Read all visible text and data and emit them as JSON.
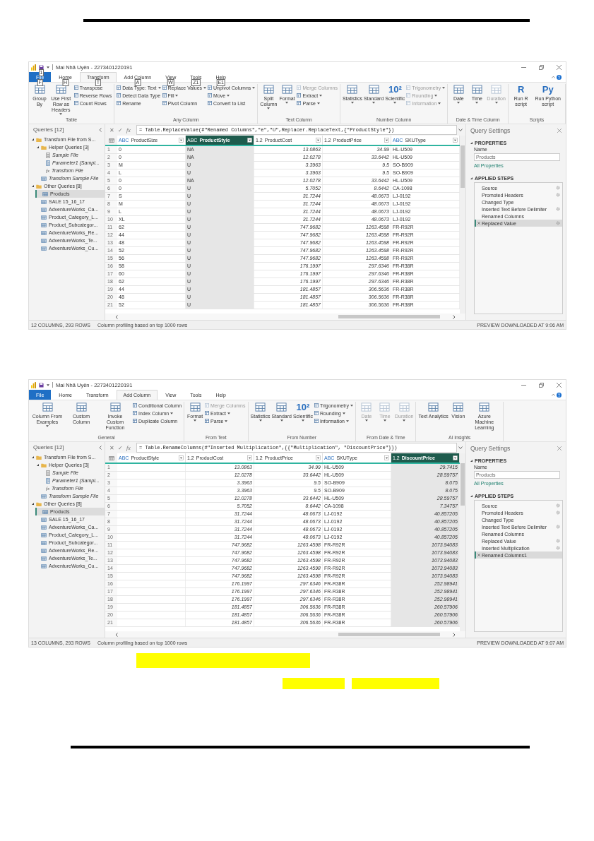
{
  "windows": [
    {
      "title_bar": {
        "title": "Mai Nhã Uyên - 2273401220191",
        "save_keytip": "1"
      },
      "tabs": [
        {
          "label": "File",
          "kind": "file",
          "selected": false,
          "keytip": "F"
        },
        {
          "label": "Home",
          "kind": "tab",
          "selected": false,
          "keytip": "H"
        },
        {
          "label": "Transform",
          "kind": "tab",
          "selected": true,
          "keytip": "T"
        },
        {
          "label": "Add Column",
          "kind": "tab",
          "selected": false,
          "keytip": "A"
        },
        {
          "label": "View",
          "kind": "tab",
          "selected": false,
          "keytip": "W"
        },
        {
          "label": "Tools",
          "kind": "tab",
          "selected": false,
          "keytip": "Z1"
        },
        {
          "label": "Help",
          "kind": "tab",
          "selected": false,
          "keytip": "E1"
        }
      ],
      "ribbon": [
        {
          "label": "Table",
          "items": [
            {
              "label": "Group By",
              "kind": "large",
              "dropdown": false,
              "disabled": false
            },
            {
              "label": "Use First Row as Headers",
              "kind": "large",
              "dropdown": true,
              "disabled": false
            },
            {
              "label": "Transpose",
              "kind": "small",
              "dropdown": false,
              "disabled": false
            },
            {
              "label": "Reverse Rows",
              "kind": "small",
              "dropdown": false,
              "disabled": false
            },
            {
              "label": "Count Rows",
              "kind": "small",
              "dropdown": false,
              "disabled": false
            }
          ]
        },
        {
          "label": "Any Column",
          "items": [
            {
              "label": "Data Type: Text",
              "kind": "small",
              "dropdown": true,
              "disabled": false
            },
            {
              "label": "Detect Data Type",
              "kind": "small",
              "dropdown": false,
              "disabled": false
            },
            {
              "label": "Rename",
              "kind": "small",
              "dropdown": false,
              "disabled": false
            },
            {
              "label": "Replace Values",
              "kind": "small",
              "dropdown": true,
              "disabled": false
            },
            {
              "label": "Fill",
              "kind": "small",
              "dropdown": true,
              "disabled": false
            },
            {
              "label": "Pivot Column",
              "kind": "small",
              "dropdown": false,
              "disabled": false
            },
            {
              "label": "Unpivot Columns",
              "kind": "small",
              "dropdown": true,
              "disabled": false
            },
            {
              "label": "Move",
              "kind": "small",
              "dropdown": true,
              "disabled": false
            },
            {
              "label": "Convert to List",
              "kind": "small",
              "dropdown": false,
              "disabled": false
            }
          ]
        },
        {
          "label": "Text Column",
          "items": [
            {
              "label": "Split Column",
              "kind": "large",
              "dropdown": true,
              "disabled": false
            },
            {
              "label": "Format",
              "kind": "large",
              "dropdown": true,
              "disabled": false
            },
            {
              "label": "Merge Columns",
              "kind": "small",
              "dropdown": false,
              "disabled": true
            },
            {
              "label": "Extract",
              "kind": "small",
              "dropdown": true,
              "disabled": false
            },
            {
              "label": "Parse",
              "kind": "small",
              "dropdown": true,
              "disabled": false
            }
          ]
        },
        {
          "label": "Number Column",
          "items": [
            {
              "label": "Statistics",
              "kind": "large",
              "dropdown": true,
              "disabled": false
            },
            {
              "label": "Standard",
              "kind": "large",
              "dropdown": true,
              "disabled": false
            },
            {
              "label": "Scientific",
              "kind": "large",
              "dropdown": true,
              "disabled": false,
              "icon_text": "10²"
            },
            {
              "label": "Trigonometry",
              "kind": "small",
              "dropdown": true,
              "disabled": true
            },
            {
              "label": "Rounding",
              "kind": "small",
              "dropdown": true,
              "disabled": true
            },
            {
              "label": "Information",
              "kind": "small",
              "dropdown": true,
              "disabled": true
            }
          ]
        },
        {
          "label": "Date & Time Column",
          "items": [
            {
              "label": "Date",
              "kind": "large",
              "dropdown": true,
              "disabled": false
            },
            {
              "label": "Time",
              "kind": "large",
              "dropdown": true,
              "disabled": false
            },
            {
              "label": "Duration",
              "kind": "large",
              "dropdown": true,
              "disabled": true
            }
          ]
        },
        {
          "label": "Scripts",
          "items": [
            {
              "label": "Run R script",
              "kind": "large",
              "dropdown": false,
              "disabled": false,
              "icon_text": "R"
            },
            {
              "label": "Run Python script",
              "kind": "large",
              "dropdown": false,
              "disabled": false,
              "icon_text": "Py"
            }
          ]
        }
      ],
      "queries": {
        "title": "Queries [12]",
        "items": [
          {
            "label": "Transform File from S...",
            "kind": "folder",
            "expanded": true,
            "selected": false,
            "disabled": false,
            "children": [
              {
                "label": "Helper Queries [3]",
                "kind": "folder",
                "expanded": true,
                "selected": false,
                "disabled": false,
                "children": [
                  {
                    "label": "Sample File",
                    "kind": "file",
                    "selected": false,
                    "disabled": true
                  },
                  {
                    "label": "Parameter1 (Sampl...",
                    "kind": "parameter",
                    "selected": false,
                    "disabled": true
                  },
                  {
                    "label": "Transform File",
                    "kind": "function",
                    "icon_text": "fx",
                    "selected": false,
                    "disabled": true
                  }
                ]
              },
              {
                "label": "Transform Sample File",
                "kind": "table",
                "selected": false,
                "disabled": true
              }
            ]
          },
          {
            "label": "Other Queries [8]",
            "kind": "folder",
            "expanded": true,
            "selected": false,
            "disabled": false,
            "children": [
              {
                "label": "Products",
                "kind": "table",
                "selected": true,
                "disabled": false
              },
              {
                "label": "SALE 15_16_17",
                "kind": "table",
                "selected": false,
                "disabled": false
              },
              {
                "label": "AdventureWorks_Ca...",
                "kind": "table",
                "selected": false,
                "disabled": false
              },
              {
                "label": "Product_Category_L...",
                "kind": "table",
                "selected": false,
                "disabled": false
              },
              {
                "label": "Product_Subcategor...",
                "kind": "table",
                "selected": false,
                "disabled": false
              },
              {
                "label": "AdventureWorks_Re...",
                "kind": "table",
                "selected": false,
                "disabled": false
              },
              {
                "label": "AdventureWorks_Te...",
                "kind": "table",
                "selected": false,
                "disabled": false
              },
              {
                "label": "AdventureWorks_Cu...",
                "kind": "table",
                "selected": false,
                "disabled": false
              }
            ]
          }
        ]
      },
      "formula": {
        "cancel": "✕",
        "commit": "✓",
        "fx": "fx",
        "text": "= Table.ReplaceValue(#\"Renamed Columns\",\"e\",\"U\",Replacer.ReplaceText,{\"ProductStyle\"})"
      },
      "columns": [
        {
          "name": "ProductSize",
          "type": "ABC",
          "kind": "text",
          "selected": false
        },
        {
          "name": "ProductStyle",
          "type": "ABC",
          "kind": "text",
          "selected": true
        },
        {
          "name": "ProductCost",
          "type": "1.2",
          "kind": "number",
          "selected": false
        },
        {
          "name": "ProductPrice",
          "type": "1.2",
          "kind": "number",
          "selected": false
        },
        {
          "name": "SKUType",
          "type": "ABC",
          "kind": "text",
          "selected": false
        }
      ],
      "rows": [
        {
          "n": "1",
          "cells": [
            "0",
            "NA",
            "13.0863",
            "34.99",
            "HL-U509"
          ]
        },
        {
          "n": "2",
          "cells": [
            "0",
            "NA",
            "12.0278",
            "33.6442",
            "HL-U509"
          ]
        },
        {
          "n": "3",
          "cells": [
            "M",
            "U",
            "3.3963",
            "9.5",
            "SO-B909"
          ]
        },
        {
          "n": "4",
          "cells": [
            "L",
            "U",
            "3.3963",
            "9.5",
            "SO-B909"
          ]
        },
        {
          "n": "5",
          "cells": [
            "0",
            "NA",
            "12.0278",
            "33.6442",
            "HL-U509"
          ]
        },
        {
          "n": "6",
          "cells": [
            "0",
            "U",
            "5.7052",
            "8.6442",
            "CA-1098"
          ]
        },
        {
          "n": "7",
          "cells": [
            "S",
            "U",
            "31.7244",
            "48.0673",
            "LJ-0192"
          ]
        },
        {
          "n": "8",
          "cells": [
            "M",
            "U",
            "31.7244",
            "48.0673",
            "LJ-0192"
          ]
        },
        {
          "n": "9",
          "cells": [
            "L",
            "U",
            "31.7244",
            "48.0673",
            "LJ-0192"
          ]
        },
        {
          "n": "10",
          "cells": [
            "XL",
            "U",
            "31.7244",
            "48.0673",
            "LJ-0192"
          ]
        },
        {
          "n": "11",
          "cells": [
            "62",
            "U",
            "747.9682",
            "1263.4598",
            "FR-R92R"
          ]
        },
        {
          "n": "12",
          "cells": [
            "44",
            "U",
            "747.9682",
            "1263.4598",
            "FR-R92R"
          ]
        },
        {
          "n": "13",
          "cells": [
            "48",
            "U",
            "747.9682",
            "1263.4598",
            "FR-R92R"
          ]
        },
        {
          "n": "14",
          "cells": [
            "52",
            "U",
            "747.9682",
            "1263.4598",
            "FR-R92R"
          ]
        },
        {
          "n": "15",
          "cells": [
            "56",
            "U",
            "747.9682",
            "1263.4598",
            "FR-R92R"
          ]
        },
        {
          "n": "16",
          "cells": [
            "58",
            "U",
            "176.1997",
            "297.6346",
            "FR-R38R"
          ]
        },
        {
          "n": "17",
          "cells": [
            "60",
            "U",
            "176.1997",
            "297.6346",
            "FR-R38R"
          ]
        },
        {
          "n": "18",
          "cells": [
            "62",
            "U",
            "176.1997",
            "297.6346",
            "FR-R38R"
          ]
        },
        {
          "n": "19",
          "cells": [
            "44",
            "U",
            "181.4857",
            "306.5636",
            "FR-R38R"
          ]
        },
        {
          "n": "20",
          "cells": [
            "48",
            "U",
            "181.4857",
            "306.5636",
            "FR-R38R"
          ]
        },
        {
          "n": "21",
          "cells": [
            "52",
            "U",
            "181.4857",
            "306.5636",
            "FR-R38R"
          ]
        }
      ],
      "settings": {
        "title": "Query Settings",
        "properties": "PROPERTIES",
        "name_label": "Name",
        "name_value": "Products",
        "all_properties": "All Properties",
        "steps_title": "APPLIED STEPS",
        "steps": [
          {
            "label": "Source",
            "gear": true,
            "selected": false
          },
          {
            "label": "Promoted Headers",
            "gear": true,
            "selected": false
          },
          {
            "label": "Changed Type",
            "gear": false,
            "selected": false
          },
          {
            "label": "Inserted Text Before Delimiter",
            "gear": true,
            "selected": false
          },
          {
            "label": "Renamed Columns",
            "gear": false,
            "selected": false
          },
          {
            "label": "Replaced Value",
            "gear": true,
            "selected": true
          }
        ]
      },
      "status": {
        "counts": "12 COLUMNS, 293 ROWS",
        "profiling": "Column profiling based on top 1000 rows",
        "preview": "PREVIEW DOWNLOADED AT 9:06 AM"
      }
    },
    {
      "title_bar": {
        "title": "Mai Nhã Uyên - 2273401220191"
      },
      "tabs": [
        {
          "label": "File",
          "kind": "file",
          "selected": false
        },
        {
          "label": "Home",
          "kind": "tab",
          "selected": false
        },
        {
          "label": "Transform",
          "kind": "tab",
          "selected": false
        },
        {
          "label": "Add Column",
          "kind": "tab",
          "selected": true
        },
        {
          "label": "View",
          "kind": "tab",
          "selected": false
        },
        {
          "label": "Tools",
          "kind": "tab",
          "selected": false
        },
        {
          "label": "Help",
          "kind": "tab",
          "selected": false
        }
      ],
      "ribbon": [
        {
          "label": "General",
          "items": [
            {
              "label": "Column From Examples",
              "kind": "large",
              "dropdown": true,
              "disabled": false
            },
            {
              "label": "Custom Column",
              "kind": "large",
              "dropdown": false,
              "disabled": false
            },
            {
              "label": "Invoke Custom Function",
              "kind": "large",
              "dropdown": false,
              "disabled": false
            },
            {
              "label": "Conditional Column",
              "kind": "small",
              "dropdown": false,
              "disabled": false
            },
            {
              "label": "Index Column",
              "kind": "small",
              "dropdown": true,
              "disabled": false
            },
            {
              "label": "Duplicate Column",
              "kind": "small",
              "dropdown": false,
              "disabled": false
            }
          ]
        },
        {
          "label": "From Text",
          "items": [
            {
              "label": "Format",
              "kind": "large",
              "dropdown": true,
              "disabled": false
            },
            {
              "label": "Merge Columns",
              "kind": "small",
              "dropdown": false,
              "disabled": true
            },
            {
              "label": "Extract",
              "kind": "small",
              "dropdown": true,
              "disabled": false
            },
            {
              "label": "Parse",
              "kind": "small",
              "dropdown": true,
              "disabled": false
            }
          ]
        },
        {
          "label": "From Number",
          "items": [
            {
              "label": "Statistics",
              "kind": "large",
              "dropdown": true,
              "disabled": false
            },
            {
              "label": "Standard",
              "kind": "large",
              "dropdown": true,
              "disabled": false
            },
            {
              "label": "Scientific",
              "kind": "large",
              "dropdown": true,
              "disabled": false,
              "icon_text": "10²"
            },
            {
              "label": "Trigonometry",
              "kind": "small",
              "dropdown": true,
              "disabled": false
            },
            {
              "label": "Rounding",
              "kind": "small",
              "dropdown": true,
              "disabled": false
            },
            {
              "label": "Information",
              "kind": "small",
              "dropdown": true,
              "disabled": false
            }
          ]
        },
        {
          "label": "From Date & Time",
          "items": [
            {
              "label": "Date",
              "kind": "large",
              "dropdown": true,
              "disabled": true
            },
            {
              "label": "Time",
              "kind": "large",
              "dropdown": true,
              "disabled": true
            },
            {
              "label": "Duration",
              "kind": "large",
              "dropdown": true,
              "disabled": true
            }
          ]
        },
        {
          "label": "AI Insights",
          "items": [
            {
              "label": "Text Analytics",
              "kind": "large",
              "dropdown": false,
              "disabled": false
            },
            {
              "label": "Vision",
              "kind": "large",
              "dropdown": false,
              "disabled": false
            },
            {
              "label": "Azure Machine Learning",
              "kind": "large",
              "dropdown": false,
              "disabled": false
            }
          ]
        }
      ],
      "queries": {
        "title": "Queries [12]",
        "items": [
          {
            "label": "Transform File from S...",
            "kind": "folder",
            "expanded": true,
            "selected": false,
            "disabled": false,
            "children": [
              {
                "label": "Helper Queries [3]",
                "kind": "folder",
                "expanded": true,
                "selected": false,
                "disabled": false,
                "children": [
                  {
                    "label": "Sample File",
                    "kind": "file",
                    "selected": false,
                    "disabled": true
                  },
                  {
                    "label": "Parameter1 (Sampl...",
                    "kind": "parameter",
                    "selected": false,
                    "disabled": true
                  },
                  {
                    "label": "Transform File",
                    "kind": "function",
                    "icon_text": "fx",
                    "selected": false,
                    "disabled": true
                  }
                ]
              },
              {
                "label": "Transform Sample File",
                "kind": "table",
                "selected": false,
                "disabled": true
              }
            ]
          },
          {
            "label": "Other Queries [8]",
            "kind": "folder",
            "expanded": true,
            "selected": false,
            "disabled": false,
            "children": [
              {
                "label": "Products",
                "kind": "table",
                "selected": true,
                "disabled": false
              },
              {
                "label": "SALE 15_16_17",
                "kind": "table",
                "selected": false,
                "disabled": false
              },
              {
                "label": "AdventureWorks_Ca...",
                "kind": "table",
                "selected": false,
                "disabled": false
              },
              {
                "label": "Product_Category_L...",
                "kind": "table",
                "selected": false,
                "disabled": false
              },
              {
                "label": "Product_Subcategor...",
                "kind": "table",
                "selected": false,
                "disabled": false
              },
              {
                "label": "AdventureWorks_Re...",
                "kind": "table",
                "selected": false,
                "disabled": false
              },
              {
                "label": "AdventureWorks_Te...",
                "kind": "table",
                "selected": false,
                "disabled": false
              },
              {
                "label": "AdventureWorks_Cu...",
                "kind": "table",
                "selected": false,
                "disabled": false
              }
            ]
          }
        ]
      },
      "formula": {
        "cancel": "✕",
        "commit": "✓",
        "fx": "fx",
        "text": "= Table.RenameColumns(#\"Inserted Multiplication\",{{\"Multiplication\", \"DiscountPrice\"}})"
      },
      "columns": [
        {
          "name": "ProductStyle",
          "type": "ABC",
          "kind": "text",
          "selected": false
        },
        {
          "name": "ProductCost",
          "type": "1.2",
          "kind": "number",
          "selected": false
        },
        {
          "name": "ProductPrice",
          "type": "1.2",
          "kind": "number",
          "selected": false
        },
        {
          "name": "SKUType",
          "type": "ABC",
          "kind": "text",
          "selected": false
        },
        {
          "name": "DiscountPrice",
          "type": "1.2",
          "kind": "number",
          "selected": true
        }
      ],
      "rows": [
        {
          "n": "1",
          "cells": [
            null,
            "13.0863",
            "34.99",
            "HL-U509",
            "29.7415"
          ]
        },
        {
          "n": "2",
          "cells": [
            null,
            "12.0278",
            "33.6442",
            "HL-U509",
            "28.59757"
          ]
        },
        {
          "n": "3",
          "cells": [
            null,
            "3.3963",
            "9.5",
            "SO-B909",
            "8.075"
          ]
        },
        {
          "n": "4",
          "cells": [
            null,
            "3.3963",
            "9.5",
            "SO-B909",
            "8.075"
          ]
        },
        {
          "n": "5",
          "cells": [
            null,
            "12.0278",
            "33.6442",
            "HL-U509",
            "28.59757"
          ]
        },
        {
          "n": "6",
          "cells": [
            null,
            "5.7052",
            "8.6442",
            "CA-1098",
            "7.34757"
          ]
        },
        {
          "n": "7",
          "cells": [
            null,
            "31.7244",
            "48.0673",
            "LJ-0192",
            "40.857205"
          ]
        },
        {
          "n": "8",
          "cells": [
            null,
            "31.7244",
            "48.0673",
            "LJ-0192",
            "40.857205"
          ]
        },
        {
          "n": "9",
          "cells": [
            null,
            "31.7244",
            "48.0673",
            "LJ-0192",
            "40.857205"
          ]
        },
        {
          "n": "10",
          "cells": [
            null,
            "31.7244",
            "48.0673",
            "LJ-0192",
            "40.857205"
          ]
        },
        {
          "n": "11",
          "cells": [
            null,
            "747.9682",
            "1263.4598",
            "FR-R92R",
            "1073.94083"
          ]
        },
        {
          "n": "12",
          "cells": [
            null,
            "747.9682",
            "1263.4598",
            "FR-R92R",
            "1073.94083"
          ]
        },
        {
          "n": "13",
          "cells": [
            null,
            "747.9682",
            "1263.4598",
            "FR-R92R",
            "1073.94083"
          ]
        },
        {
          "n": "14",
          "cells": [
            null,
            "747.9682",
            "1263.4598",
            "FR-R92R",
            "1073.94083"
          ]
        },
        {
          "n": "15",
          "cells": [
            null,
            "747.9682",
            "1263.4598",
            "FR-R92R",
            "1073.94083"
          ]
        },
        {
          "n": "16",
          "cells": [
            null,
            "176.1997",
            "297.6346",
            "FR-R38R",
            "252.98941"
          ]
        },
        {
          "n": "17",
          "cells": [
            null,
            "176.1997",
            "297.6346",
            "FR-R38R",
            "252.98941"
          ]
        },
        {
          "n": "18",
          "cells": [
            null,
            "176.1997",
            "297.6346",
            "FR-R38R",
            "252.98941"
          ]
        },
        {
          "n": "19",
          "cells": [
            null,
            "181.4857",
            "306.5636",
            "FR-R38R",
            "260.57906"
          ]
        },
        {
          "n": "20",
          "cells": [
            null,
            "181.4857",
            "306.5636",
            "FR-R38R",
            "260.57906"
          ]
        },
        {
          "n": "21",
          "cells": [
            null,
            "181.4857",
            "306.5636",
            "FR-R38R",
            "260.57906"
          ]
        }
      ],
      "settings": {
        "title": "Query Settings",
        "properties": "PROPERTIES",
        "name_label": "Name",
        "name_value": "Products",
        "all_properties": "All Properties",
        "steps_title": "APPLIED STEPS",
        "steps": [
          {
            "label": "Source",
            "gear": true,
            "selected": false
          },
          {
            "label": "Promoted Headers",
            "gear": true,
            "selected": false
          },
          {
            "label": "Changed Type",
            "gear": false,
            "selected": false
          },
          {
            "label": "Inserted Text Before Delimiter",
            "gear": true,
            "selected": false
          },
          {
            "label": "Renamed Columns",
            "gear": false,
            "selected": false
          },
          {
            "label": "Replaced Value",
            "gear": true,
            "selected": false
          },
          {
            "label": "Inserted Multiplication",
            "gear": true,
            "selected": false
          },
          {
            "label": "Renamed Columns1",
            "gear": false,
            "selected": true
          }
        ]
      },
      "status": {
        "counts": "13 COLUMNS, 293 ROWS",
        "profiling": "Column profiling based on top 1000 rows",
        "preview": "PREVIEW DOWNLOADED AT 9:07 AM"
      }
    }
  ]
}
